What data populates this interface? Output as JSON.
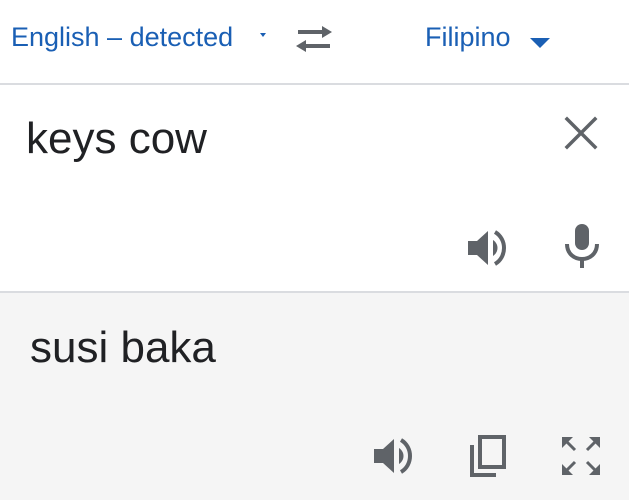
{
  "language_bar": {
    "source_language": "English – detected",
    "target_language": "Filipino",
    "accent_color": "#1a5fb4"
  },
  "input": {
    "text": "keys cow",
    "icons": [
      "close-icon",
      "speaker-icon",
      "microphone-icon"
    ]
  },
  "output": {
    "text": "susi baka",
    "icons": [
      "speaker-icon",
      "copy-icon",
      "fullscreen-icon"
    ]
  }
}
